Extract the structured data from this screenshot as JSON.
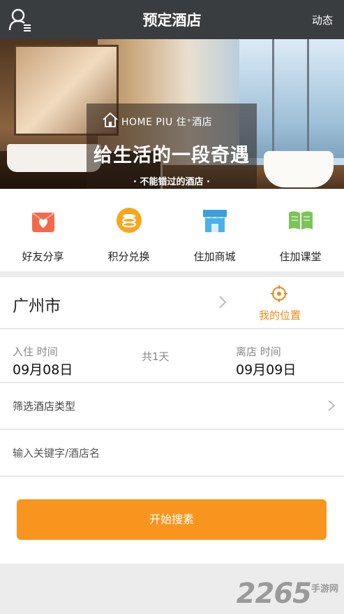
{
  "header": {
    "title": "预定酒店",
    "right_label": "动态"
  },
  "banner": {
    "brand": "HOME PIU 住⁺酒店",
    "slogan": "给生活的一段奇遇",
    "subline": "· 不能错过的酒店 ·"
  },
  "quick_actions": [
    {
      "label": "好友分享",
      "icon": "heart-gift-icon",
      "color": "#f26a4b"
    },
    {
      "label": "积分兑换",
      "icon": "coins-icon",
      "color": "#f5a81e"
    },
    {
      "label": "住加商城",
      "icon": "shop-icon",
      "color": "#4ab1e8"
    },
    {
      "label": "住加课堂",
      "icon": "book-icon",
      "color": "#7cc35a"
    }
  ],
  "location": {
    "city": "广州市",
    "my_location": "我的位置"
  },
  "dates": {
    "checkin_label": "入住 时间",
    "checkin_value": "09月08日",
    "duration": "共1天",
    "checkout_label": "离店 时间",
    "checkout_value": "09月09日"
  },
  "filter": {
    "label": "筛选酒店类型"
  },
  "search": {
    "placeholder": "输入关键字/酒店名",
    "button": "开始搜素"
  },
  "watermark": {
    "text": "2265",
    "sub": "手游网"
  },
  "colors": {
    "header_bg": "#3a3d40",
    "accent": "#f7951f"
  }
}
